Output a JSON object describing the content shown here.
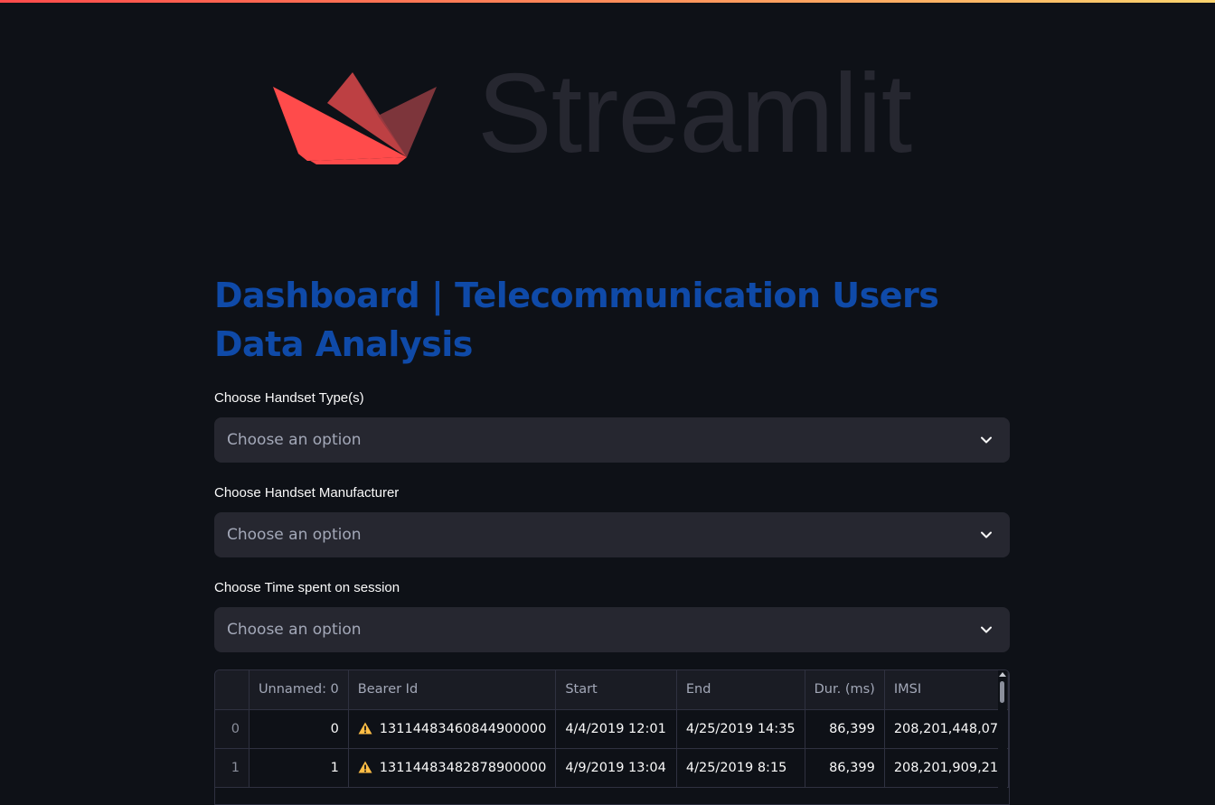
{
  "brand": {
    "logo_text": "Streamlit",
    "accent_color": "#ff4b4b"
  },
  "page": {
    "title": "Dashboard | Telecommunication Users Data Analysis"
  },
  "filters": [
    {
      "label": "Choose Handset Type(s)",
      "placeholder": "Choose an option"
    },
    {
      "label": "Choose Handset Manufacturer",
      "placeholder": "Choose an option"
    },
    {
      "label": "Choose Time spent on session",
      "placeholder": "Choose an option"
    }
  ],
  "table": {
    "columns": [
      "",
      "Unnamed: 0",
      "Bearer Id",
      "Start",
      "End",
      "Dur. (ms)",
      "IMSI"
    ],
    "rows": [
      {
        "index": "0",
        "unnamed": "0",
        "bearer_id": "13114483460844900000",
        "start": "4/4/2019 12:01",
        "end": "4/25/2019 14:35",
        "dur": "86,399",
        "imsi": "208,201,448,07"
      },
      {
        "index": "1",
        "unnamed": "1",
        "bearer_id": "13114483482878900000",
        "start": "4/9/2019 13:04",
        "end": "4/25/2019 8:15",
        "dur": "86,399",
        "imsi": "208,201,909,21"
      }
    ]
  }
}
